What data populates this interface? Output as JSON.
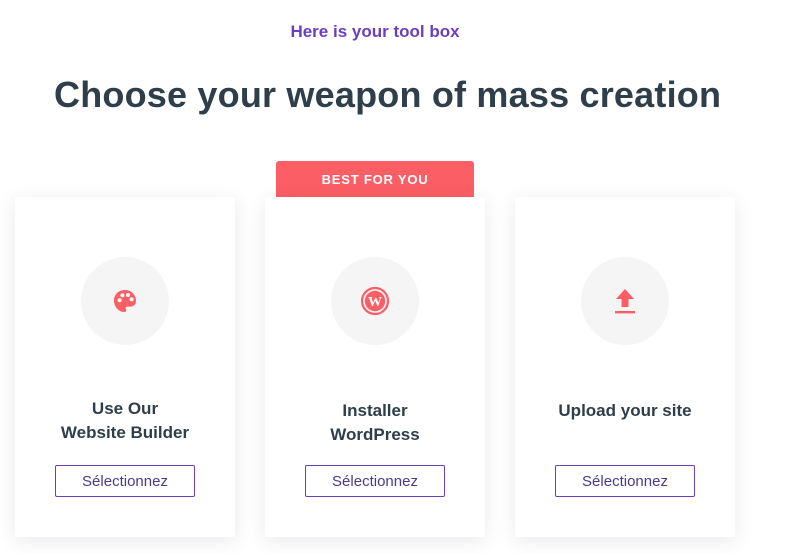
{
  "kicker": "Here is your tool box",
  "headline": "Choose your weapon of mass creation",
  "ribbon": "BEST FOR YOU",
  "accent_color": "#fb5e64",
  "brand_color": "#6a3fbf",
  "cards": [
    {
      "icon": "palette-icon",
      "title_lines": [
        "Use Our",
        "Website Builder"
      ],
      "button": "Sélectionnez"
    },
    {
      "icon": "wordpress-icon",
      "title_lines": [
        "Installer",
        "WordPress"
      ],
      "button": "Sélectionnez"
    },
    {
      "icon": "upload-icon",
      "title_lines": [
        "Upload your site"
      ],
      "button": "Sélectionnez"
    }
  ]
}
